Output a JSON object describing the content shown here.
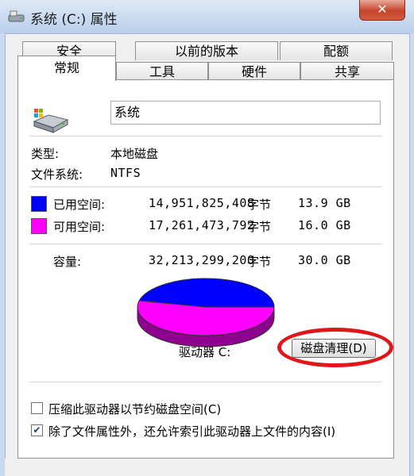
{
  "window": {
    "title": "系统 (C:) 属性",
    "close_label": "✕"
  },
  "tabs_back": [
    {
      "label": "安全"
    },
    {
      "label": "以前的版本"
    },
    {
      "label": "配额"
    }
  ],
  "tabs_front": [
    {
      "label": "常规",
      "active": true
    },
    {
      "label": "工具"
    },
    {
      "label": "硬件"
    },
    {
      "label": "共享"
    }
  ],
  "general": {
    "drive_name": "系统",
    "type_label": "类型:",
    "type_value": "本地磁盘",
    "fs_label": "文件系统:",
    "fs_value": "NTFS",
    "used": {
      "label": "已用空间:",
      "bytes": "14,951,825,408",
      "unit": "字节",
      "size": "13.9 GB",
      "color": "#0000ff"
    },
    "free": {
      "label": "可用空间:",
      "bytes": "17,261,473,792",
      "unit": "字节",
      "size": "16.0 GB",
      "color": "#ff00ff"
    },
    "capacity": {
      "label": "容量:",
      "bytes": "32,213,299,200",
      "unit": "字节",
      "size": "30.0 GB"
    },
    "drive_label": "驱动器 C:",
    "cleanup_button": "磁盘清理(D)",
    "compress_checkbox": {
      "label": "压缩此驱动器以节约磁盘空间(C)",
      "checked": false
    },
    "index_checkbox": {
      "label": "除了文件属性外，还允许索引此驱动器上文件的内容(I)",
      "checked": true
    }
  },
  "pie_chart": {
    "used_fraction": 0.464,
    "free_fraction": 0.536
  }
}
